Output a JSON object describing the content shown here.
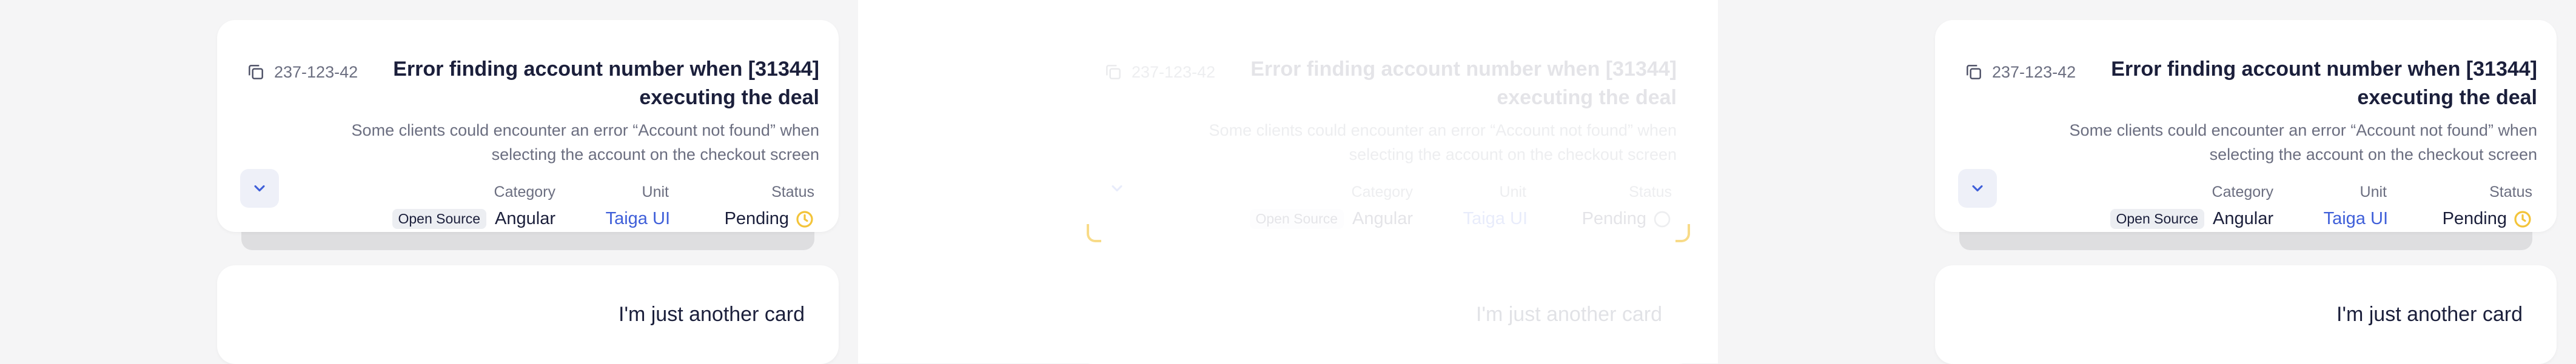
{
  "card": {
    "code": "237-123-42",
    "title": "Error finding account number when [31344] executing the deal",
    "description": "Some clients could encounter an error “Account not found” when selecting the account on the checkout screen",
    "columns": {
      "category_label": "Category",
      "unit_label": "Unit",
      "status_label": "Status",
      "category_tag": "Open Source",
      "category_value": "Angular",
      "unit_value": "Taiga UI",
      "status_value": "Pending"
    }
  },
  "second_card": {
    "text": "I'm just another card"
  },
  "colors": {
    "accent_link": "#3f5fd9",
    "pending": "#f3c43a",
    "page_bg": "#f5f5f6"
  },
  "icons": [
    "copy-icon",
    "chevron-down-icon",
    "clock-icon"
  ]
}
